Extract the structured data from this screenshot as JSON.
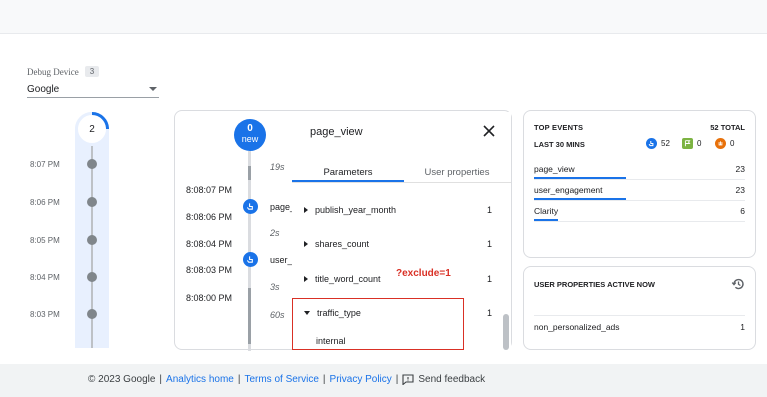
{
  "debug_device": {
    "label": "Debug Device",
    "count": "3",
    "selected": "Google"
  },
  "minutes_stream": {
    "current_count": "2",
    "times": [
      "8:07 PM",
      "8:06 PM",
      "8:05 PM",
      "8:04 PM",
      "8:03 PM"
    ]
  },
  "seconds_stream": {
    "new_count": "0",
    "new_label": "new",
    "gaps": [
      "19s",
      "2s",
      "3s",
      "60s"
    ],
    "times": [
      "8:08:07 PM",
      "8:08:06 PM",
      "8:08:04 PM",
      "8:08:03 PM",
      "8:08:00 PM"
    ],
    "events": [
      "page_v",
      "user_e"
    ]
  },
  "event_panel": {
    "title": "page_view",
    "tabs": [
      "Parameters",
      "User properties"
    ],
    "params": [
      {
        "name": "publish_year_month",
        "value": "1"
      },
      {
        "name": "shares_count",
        "value": "1"
      },
      {
        "name": "title_word_count",
        "value": "1"
      },
      {
        "name": "traffic_type",
        "value": "1"
      }
    ],
    "expanded_value": "internal",
    "annotation": "?exclude=1"
  },
  "top_events": {
    "title": "TOP EVENTS",
    "total": "52 TOTAL",
    "subtitle": "LAST 30 MINS",
    "counters": [
      {
        "icon": "hand-pointer-icon",
        "value": "52",
        "color": "#1a73e8"
      },
      {
        "icon": "flag-icon",
        "value": "0",
        "color": "#7cb342"
      },
      {
        "icon": "error-icon",
        "value": "0",
        "color": "#e8710a"
      }
    ],
    "rows": [
      {
        "name": "page_view",
        "value": "23",
        "fraction": 1.0
      },
      {
        "name": "user_engagement",
        "value": "23",
        "fraction": 1.0
      },
      {
        "name": "Clarity",
        "value": "6",
        "fraction": 0.26
      }
    ]
  },
  "user_properties": {
    "title": "USER PROPERTIES ACTIVE NOW",
    "rows": [
      {
        "name": "non_personalized_ads",
        "value": "1"
      }
    ]
  },
  "footer": {
    "copyright": "© 2023 Google",
    "links": [
      "Analytics home",
      "Terms of Service",
      "Privacy Policy"
    ],
    "feedback": "Send feedback"
  },
  "colors": {
    "accent": "#1a73e8",
    "highlight": "#d93025"
  }
}
